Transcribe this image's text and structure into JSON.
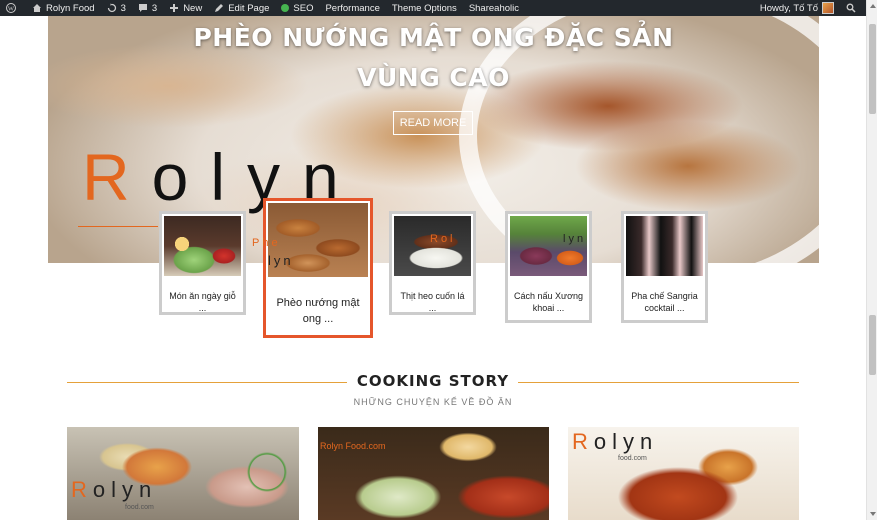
{
  "adminbar": {
    "site_name": "Rolyn Food",
    "updates_count": "3",
    "comments_count": "3",
    "new_label": "New",
    "edit_page_label": "Edit Page",
    "seo_label": "SEO",
    "performance_label": "Performance",
    "theme_options_label": "Theme Options",
    "shareaholic_label": "Shareaholic",
    "greeting": "Howdy, Tố Tố"
  },
  "hero": {
    "title_line1": "PHÈO NƯỚNG MẬT ONG ĐẶC SẢN",
    "title_line2": "VÙNG CAO",
    "button_label": "READ MORE",
    "logo_text": "Rolyn",
    "logo_first": "R",
    "logo_rest": "olyn"
  },
  "slider": [
    {
      "caption": "Món ăn ngày giỗ ..."
    },
    {
      "caption": "Phèo nướng mật ong ...",
      "active": true
    },
    {
      "caption": "Thịt heo cuốn lá ..."
    },
    {
      "caption": "Cách nấu Xương khoai ..."
    },
    {
      "caption": "Pha chế Sangria cocktail ..."
    }
  ],
  "watermarks": {
    "b_phe": "Phe",
    "b_lyn": "lyn",
    "b_sub": "Rolyn",
    "c_text": "Rol",
    "d_text": "lyn"
  },
  "section": {
    "title": "COOKING STORY",
    "subtitle": "NHỮNG CHUYỆN KỂ VỀ ĐỒ ĂN"
  },
  "cards": [
    {
      "wm_first": "R",
      "wm_rest": "olyn",
      "wm_sub": "food.com"
    },
    {
      "wm_text": "Rolyn Food.com"
    },
    {
      "wm_first": "R",
      "wm_rest": "olyn",
      "wm_sub": "food.com"
    }
  ],
  "colors": {
    "accent_orange": "#e3671f",
    "active_border": "#e5562b",
    "section_line": "#e5a13a",
    "adminbar_bg": "#23282d"
  }
}
